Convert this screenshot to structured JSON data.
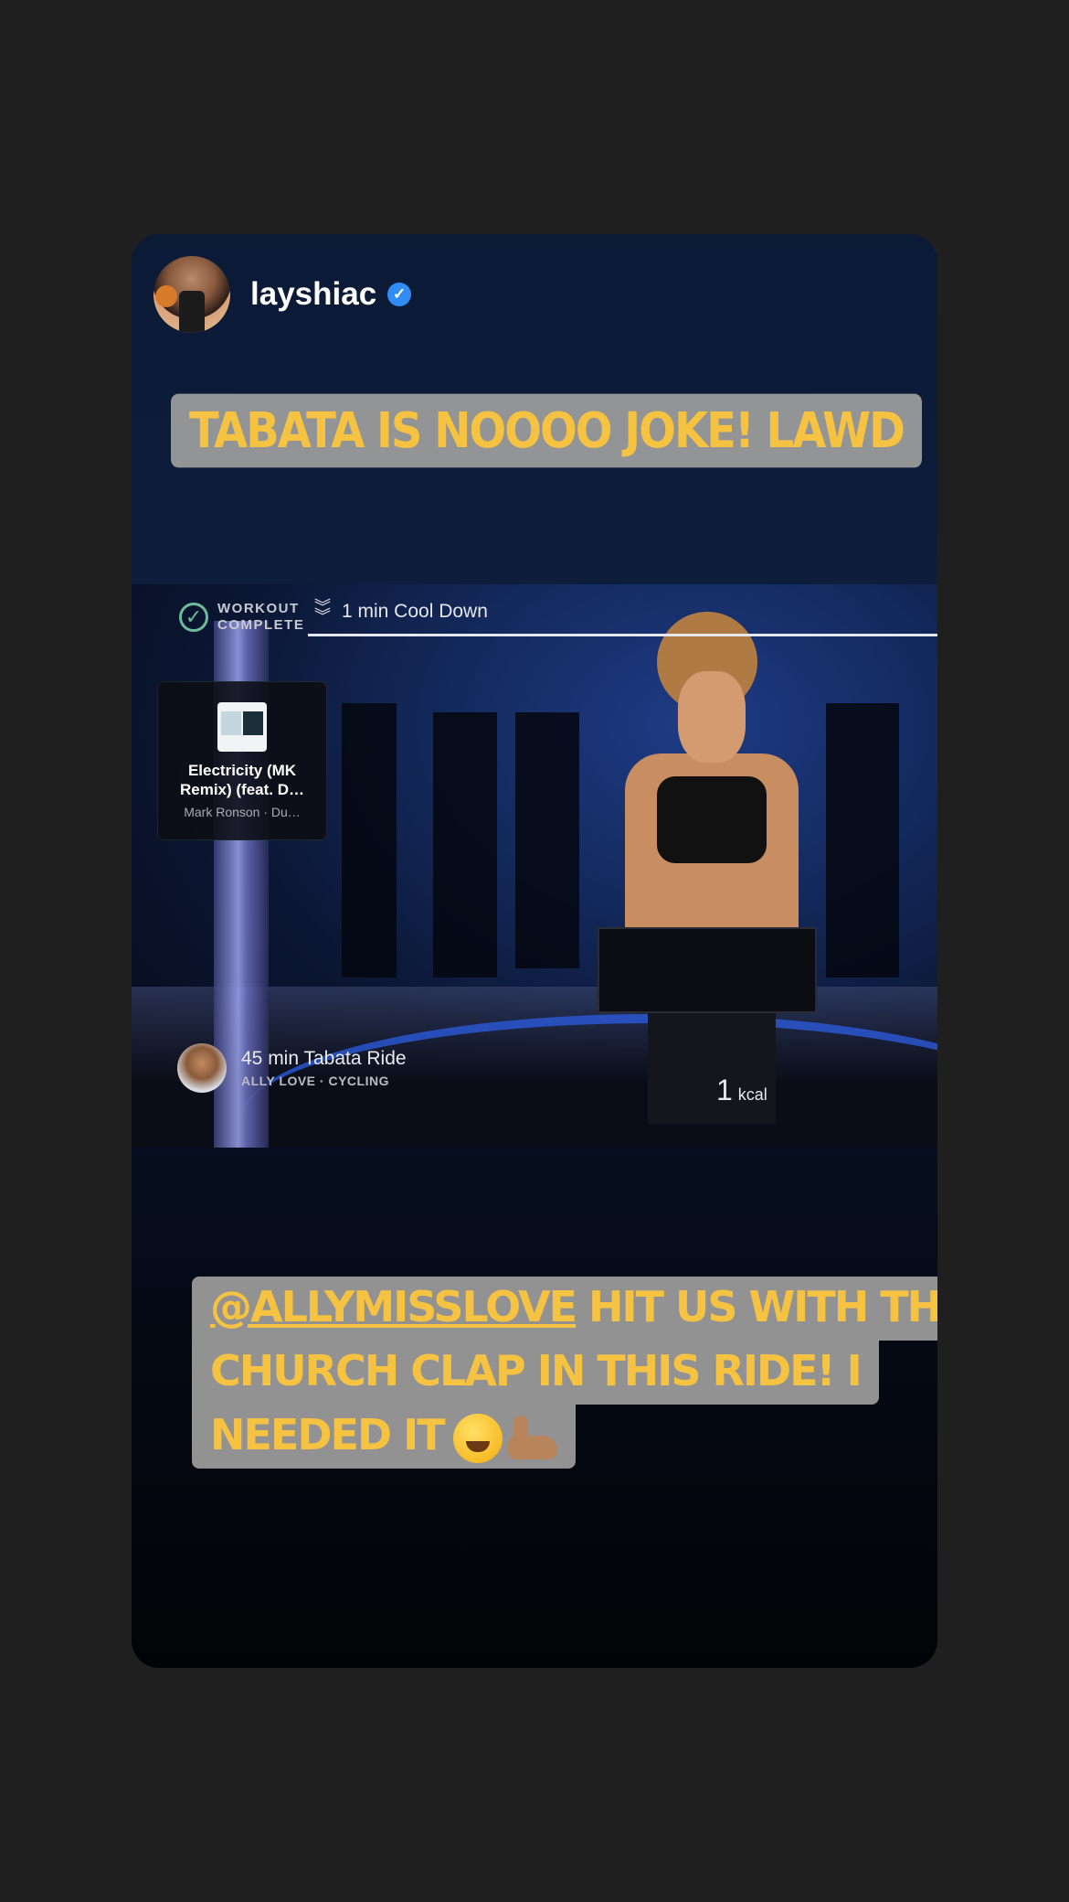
{
  "story": {
    "username": "layshiac",
    "verified": true,
    "caption_top": "TABATA IS NOOOO JOKE! LAWD",
    "caption_bottom": {
      "mention": "@ALLYMISSLOVE",
      "line1_rest": " HIT US WITH THE",
      "line2": "CHURCH CLAP IN THIS RIDE! I",
      "line3": "NEEDED IT"
    },
    "emojis": [
      "tired-face-emoji",
      "flexed-biceps-emoji"
    ]
  },
  "workout": {
    "status_line1": "WORKOUT",
    "status_line2": "COMPLETE",
    "segment": "1 min Cool Down",
    "song": {
      "title": "Electricity (MK Remix) (feat. D…",
      "artist": "Mark Ronson · Du…"
    },
    "class_title": "45 min Tabata Ride",
    "class_meta": "ALLY LOVE · CYCLING",
    "kcal_value": "1",
    "kcal_unit": "kcal"
  },
  "colors": {
    "caption_text": "#f6c242",
    "caption_bg": "#9e9e9e",
    "verified_badge": "#2f8df5",
    "page_bg": "#1f1f1f"
  }
}
